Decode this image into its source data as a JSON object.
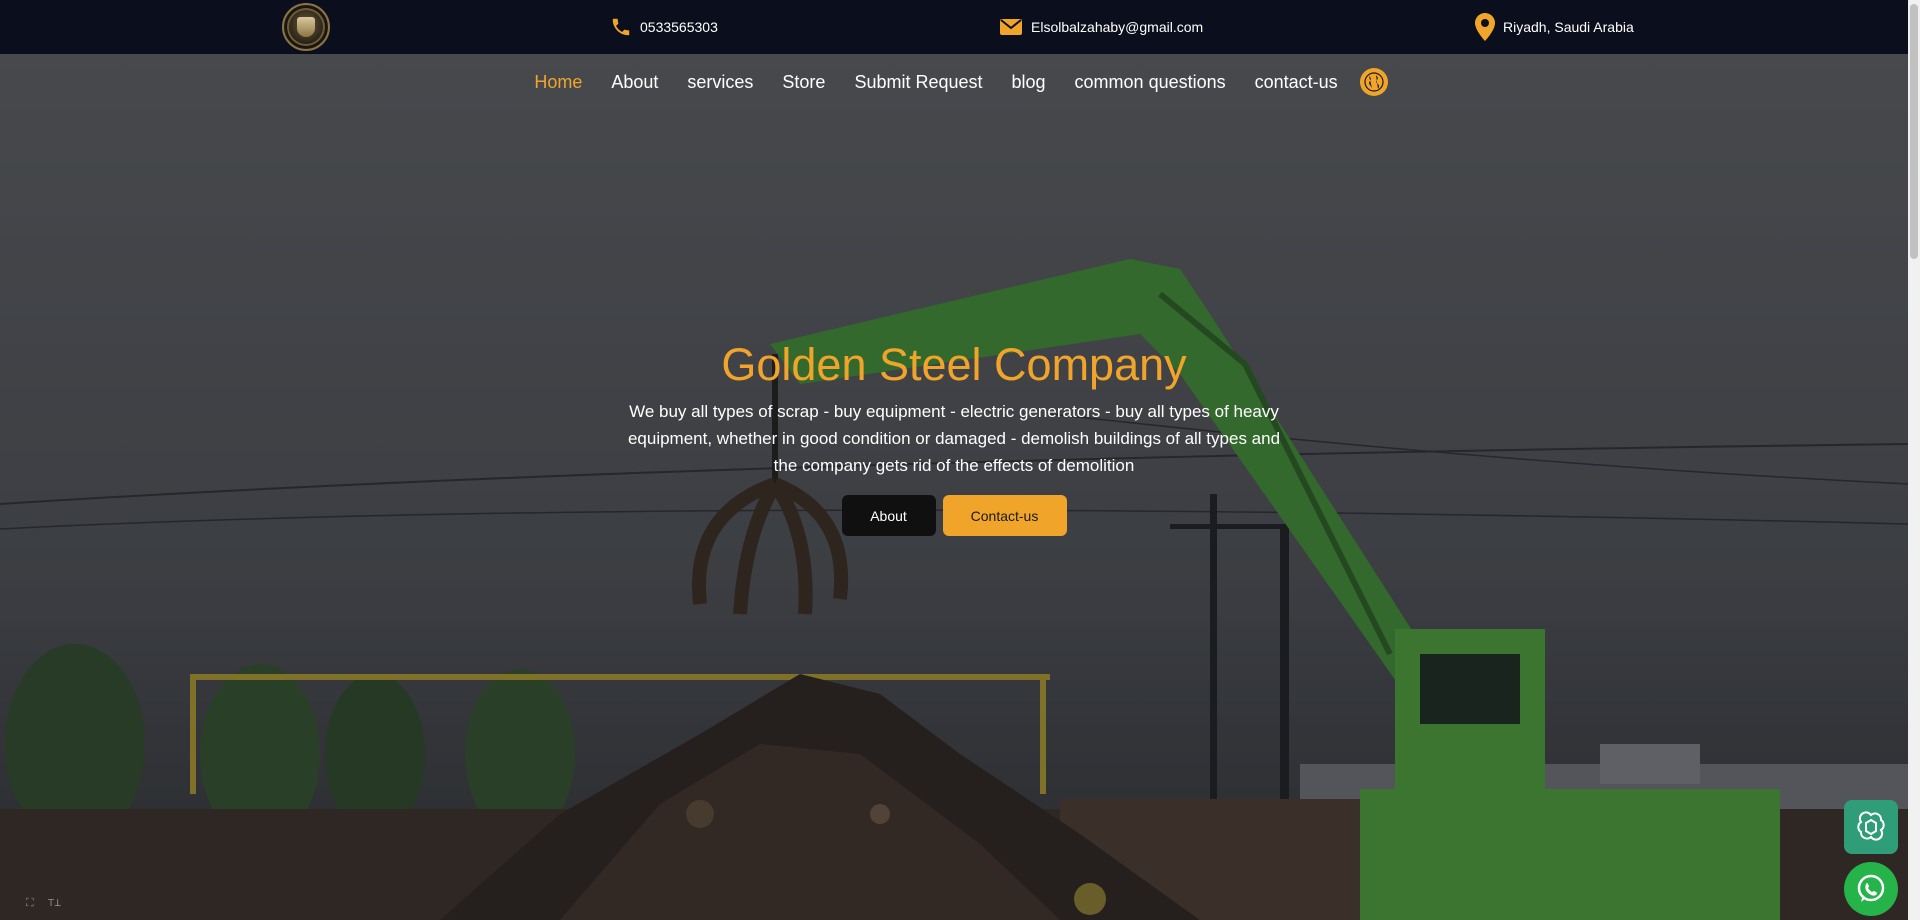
{
  "topbar": {
    "logo_icon": "company-seal-logo",
    "phone": "0533565303",
    "email": "Elsolbalzahaby@gmail.com",
    "location": "Riyadh, Saudi Arabia",
    "icon_color": "#f0a52a"
  },
  "nav": {
    "items": [
      {
        "label": "Home",
        "active": true
      },
      {
        "label": "About"
      },
      {
        "label": "services"
      },
      {
        "label": "Store"
      },
      {
        "label": "Submit Request"
      },
      {
        "label": "blog"
      },
      {
        "label": "common questions"
      },
      {
        "label": "contact-us"
      }
    ],
    "language_icon": "globe-icon"
  },
  "hero": {
    "title": "Golden Steel Company",
    "description": "We buy all types of scrap - buy equipment - electric generators - buy all types of heavy equipment, whether in good condition or damaged - demolish buildings of all types and the company gets rid of the effects of demolition",
    "about_button": "About",
    "contact_button": "Contact-us",
    "accent_color": "#f0a52a"
  },
  "widgets": {
    "chat_icon": "openai-chat-icon",
    "whatsapp_icon": "whatsapp-icon"
  }
}
